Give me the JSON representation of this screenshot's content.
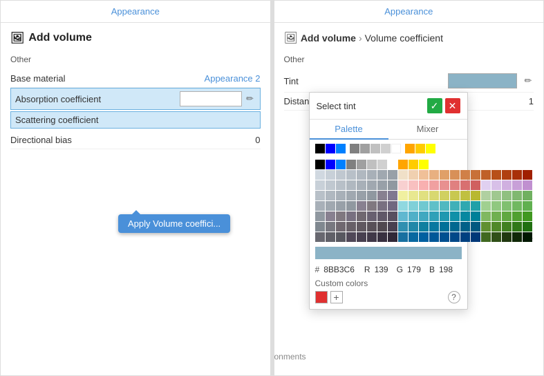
{
  "leftPanel": {
    "header": "Appearance",
    "title": "Add volume",
    "section": "Other",
    "fields": [
      {
        "label": "Base material",
        "value": "Appearance 2",
        "type": "link"
      },
      {
        "label": "Absorption coefficient",
        "value": "",
        "type": "input",
        "highlighted": true
      },
      {
        "label": "Scattering coefficient",
        "value": "",
        "type": "input",
        "highlighted": true
      },
      {
        "label": "Directional bias",
        "value": "0",
        "type": "text"
      }
    ],
    "tooltip": "Apply Volume coeffici..."
  },
  "rightPanel": {
    "header": "Appearance",
    "title": "Add volume",
    "breadcrumb": "Volume coefficient",
    "section": "Other",
    "fields": [
      {
        "label": "Tint",
        "type": "swatch",
        "color": "#8BB3C6"
      },
      {
        "label": "Distance",
        "value": "1",
        "type": "text"
      }
    ]
  },
  "colorPicker": {
    "title": "Select tint",
    "tabs": [
      "Palette",
      "Mixer"
    ],
    "activeTab": "Palette",
    "hexLabel": "#",
    "hexValue": "8BB3C6",
    "rLabel": "R",
    "rValue": "139",
    "gLabel": "G",
    "gValue": "179",
    "bLabel": "B",
    "bValue": "198",
    "customColorsLabel": "Custom colors",
    "selectedColor": "#8BB3C6",
    "palette": [
      [
        "#000000",
        "#0000ff",
        "#0080ff",
        "#808080",
        "#a0a0a0",
        "#c0c0c0",
        "#d0d0d0",
        "#ffffff",
        "#ffa500",
        "#ffcc00",
        "#ffff00"
      ],
      [
        "#d0d8e0",
        "#c8d0d8",
        "#c0c8d0",
        "#b8c0c8",
        "#b0b8c0",
        "#a8b0b8",
        "#a0a8b0",
        "#98a0a8",
        "#f0e0c8",
        "#f0d0b0",
        "#f0c098",
        "#e8b080",
        "#e0a068",
        "#d89058",
        "#d08048",
        "#c87038",
        "#c06028",
        "#b85018",
        "#b04010",
        "#a83008",
        "#a02000"
      ],
      [
        "#c8d0d8",
        "#c0c8d0",
        "#b8c0c8",
        "#b0b8c0",
        "#a8b0b8",
        "#a0a8b0",
        "#98a0a8",
        "#9098a0",
        "#f8d0d0",
        "#f8c0c0",
        "#f8b0b0",
        "#f0a0a0",
        "#e89090",
        "#e08080",
        "#d87070",
        "#d06060",
        "#e0d0f0",
        "#d8c0e8",
        "#d0b0e0",
        "#c8a0d8",
        "#c090d0"
      ],
      [
        "#b8c0c8",
        "#b0b8c0",
        "#a8b0b8",
        "#a0a8b0",
        "#98a0a8",
        "#9098a0",
        "#888090",
        "#807890",
        "#f0f0a0",
        "#e8e890",
        "#e0e080",
        "#d8d870",
        "#d0d060",
        "#c8c850",
        "#c0c040",
        "#b8b830",
        "#b0d0a0",
        "#a0c890",
        "#90c080",
        "#80b870",
        "#70b060"
      ],
      [
        "#a8b0b8",
        "#a0a8b0",
        "#98a0a8",
        "#9098a0",
        "#888090",
        "#807880",
        "#787080",
        "#706880",
        "#90d8e0",
        "#80d0d8",
        "#70c8d0",
        "#60c0c8",
        "#50b8c0",
        "#40b0b8",
        "#30a8b0",
        "#20a0a8",
        "#a0d090",
        "#90c880",
        "#80c070",
        "#70b860",
        "#60b050"
      ],
      [
        "#9098a0",
        "#888090",
        "#807880",
        "#787080",
        "#706870",
        "#686070",
        "#605868",
        "#585060",
        "#60b8d0",
        "#50b0c8",
        "#40a8c0",
        "#30a0b8",
        "#2098b0",
        "#1090a8",
        "#0888a0",
        "#008098",
        "#80b860",
        "#70b050",
        "#60a840",
        "#50a030",
        "#409820"
      ],
      [
        "#808890",
        "#787880",
        "#706870",
        "#686068",
        "#605860",
        "#585058",
        "#504850",
        "#484050",
        "#3090b0",
        "#2088a8",
        "#1080a0",
        "#0878a0",
        "#007098",
        "#006890",
        "#006088",
        "#005880",
        "#609030",
        "#508828",
        "#408020",
        "#307818",
        "#207010"
      ],
      [
        "#686870",
        "#606068",
        "#585860",
        "#504858",
        "#484050",
        "#403848",
        "#383040",
        "#302838",
        "#1870a0",
        "#0868a0",
        "#0060a0",
        "#005898",
        "#005090",
        "#004888",
        "#004080",
        "#003878",
        "#406820",
        "#305018",
        "#203810",
        "#102808",
        "#001800"
      ]
    ],
    "icons": {
      "confirm": "✓",
      "cancel": "✕",
      "help": "?"
    }
  }
}
